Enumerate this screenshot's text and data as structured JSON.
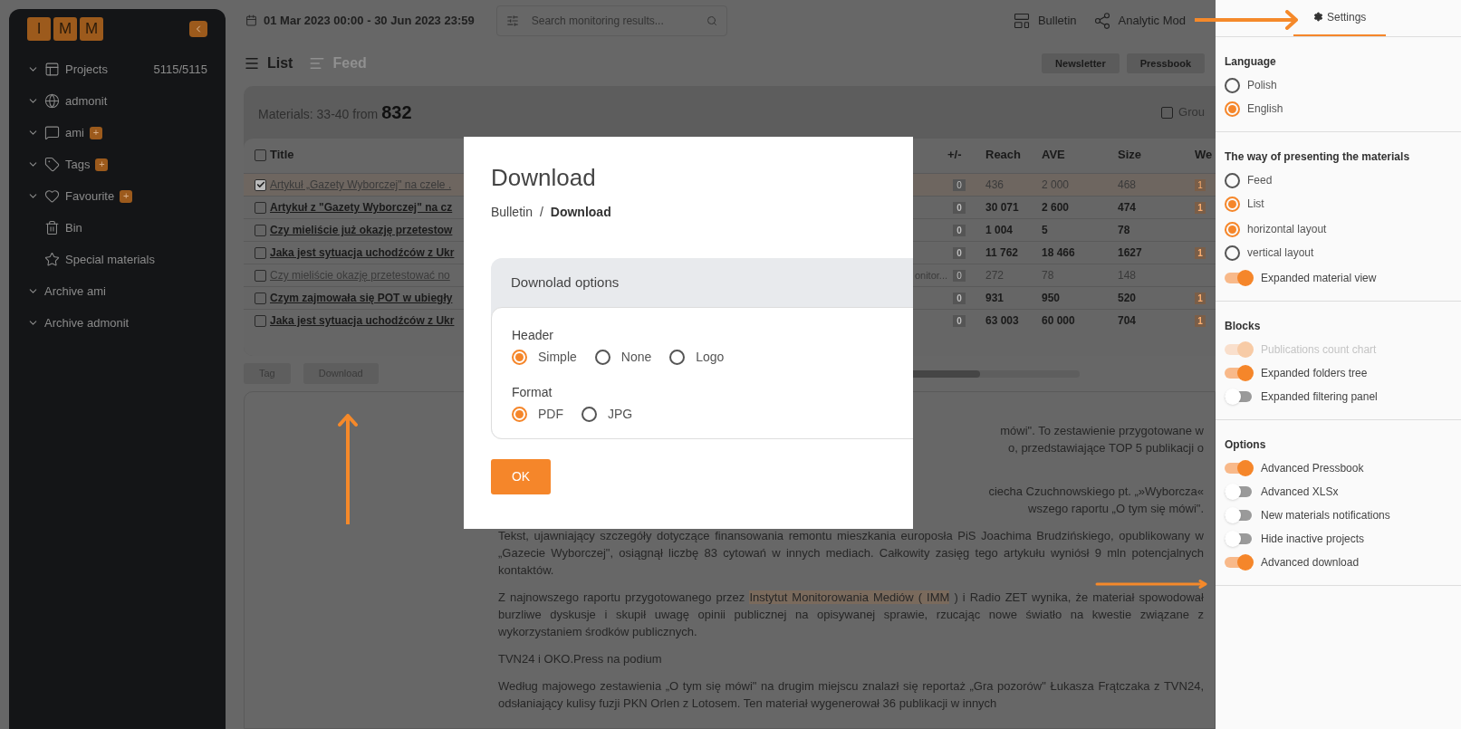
{
  "sidebar": {
    "logo": [
      "I",
      "M",
      "M"
    ],
    "items": [
      {
        "kind": "folder",
        "label": "Projects",
        "count": "5115/5115"
      },
      {
        "kind": "folder",
        "label": "admonit"
      },
      {
        "kind": "folder",
        "label": "ami",
        "badge": "+"
      },
      {
        "kind": "folder",
        "label": "Tags",
        "badge": "+"
      },
      {
        "kind": "folder",
        "label": "Favourite",
        "badge": "+"
      },
      {
        "kind": "leaf",
        "label": "Bin"
      },
      {
        "kind": "leaf",
        "label": "Special materials"
      },
      {
        "kind": "folder",
        "label": "Archive ami"
      },
      {
        "kind": "folder",
        "label": "Archive admonit"
      }
    ]
  },
  "top_bar": {
    "date_range": "01 Mar 2023 00:00 - 30 Jun 2023 23:59",
    "search": {
      "placeholder": "Search monitoring results..."
    },
    "nav": [
      "Bulletin",
      "Analytic Mod"
    ]
  },
  "view_tabs": [
    {
      "label": "List",
      "selected": true
    },
    {
      "label": "Feed",
      "selected": false
    }
  ],
  "actions": [
    "Newsletter",
    "Pressbook"
  ],
  "materials": {
    "label": "Materials:",
    "range": "33-40 from",
    "total": "832",
    "group": {
      "label": "Grou",
      "checked": false
    }
  },
  "table": {
    "select_all": {
      "checked": false
    },
    "columns": [
      "Title",
      "+/-",
      "Reach",
      "AVE",
      "Size",
      "We"
    ],
    "rows": [
      {
        "checked": true,
        "bold": false,
        "title": "Artykuł „Gazety Wyborczej\" na czele .",
        "change": "0",
        "reach": "436",
        "ave": "2 000",
        "size": "468",
        "weight": "1"
      },
      {
        "checked": false,
        "bold": true,
        "title": "Artykuł z \"Gazety Wyborczej\" na cz",
        "change": "0",
        "reach": "30 071",
        "ave": "2 600",
        "size": "474",
        "weight": "1"
      },
      {
        "checked": false,
        "bold": true,
        "title": "Czy mieliście już okazję przetestow",
        "change": "0",
        "reach": "1 004",
        "ave": "5",
        "size": "78"
      },
      {
        "checked": false,
        "bold": true,
        "title": "Jaka jest sytuacja uchodźców z Ukr",
        "change": "0",
        "reach": "11 762",
        "ave": "18 466",
        "size": "1627",
        "weight": "1"
      },
      {
        "checked": false,
        "bold": false,
        "title": "Czy mieliście okazję przetestować no",
        "column_3": "onitor...",
        "change": "0",
        "reach": "272",
        "ave": "78",
        "size": "148"
      },
      {
        "checked": false,
        "bold": true,
        "title": "Czym zajmowała się POT w ubiegły",
        "change": "0",
        "reach": "931",
        "ave": "950",
        "size": "520",
        "weight": "1"
      },
      {
        "checked": false,
        "bold": true,
        "title": "Jaka jest sytuacja uchodźców z Ukr",
        "change": "0",
        "reach": "63 003",
        "ave": "60 000",
        "size": "704",
        "weight": "1"
      }
    ]
  },
  "bulk_actions": [
    "Tag",
    "Download"
  ],
  "article": {
    "paragraphs": [
      {
        "kind": "partial",
        "lines": [
          "mówi\". To zestawienie przygotowane w",
          "o, przedstawiające TOP 5 publikacji o"
        ]
      },
      {
        "kind": "partial",
        "lines": [
          "ciecha Czuchnowskiego pt. „»Wyborcza«",
          "wszego raportu „O tym się mówi\"."
        ]
      },
      {
        "kind": "full",
        "segments": [
          {
            "text": "Tekst, ujawniający szczegóły dotyczące finansowania remontu mieszkania europosła PiS Joachima Brudzińskiego, opublikowany w „Gazecie Wyborczej\", osiągnął liczbę 83 cytowań w innych mediach. Całkowity zasięg tego artykułu wyniósł 9 mln potencjalnych kontaktów.",
            "highlighted": false
          }
        ]
      },
      {
        "kind": "full",
        "segments": [
          {
            "text": "Z najnowszego raportu przygotowanego przez ",
            "highlighted": false
          },
          {
            "text": "Instytut Monitorowania Mediów ( IMM",
            "highlighted": true
          },
          {
            "text": " ) i Radio ZET wynika, że materiał spowodował burzliwe dyskusje i skupił uwagę opinii publicznej na opisywanej sprawie, rzucając nowe światło na kwestie związane z wykorzystaniem środków publicznych.",
            "highlighted": false
          }
        ]
      },
      {
        "kind": "full",
        "segments": [
          {
            "text": "TVN24 i OKO.Press na podium",
            "highlighted": false
          }
        ]
      },
      {
        "kind": "full",
        "segments": [
          {
            "text": "Według majowego zestawienia „O tym się mówi\" na drugim miejscu znalazł się reportaż „Gra pozorów\" Łukasza Frątczaka z TVN24, odsłaniający kulisy fuzji PKN Orlen z Lotosem. Ten materiał wygenerował 36 publikacji w innych",
            "highlighted": false
          }
        ]
      }
    ]
  },
  "modal": {
    "title": "Download",
    "breadcrumb": [
      "Bulletin",
      "Download"
    ],
    "separator": "/",
    "options_title": "Downolad options",
    "groups": [
      {
        "label": "Header",
        "options": [
          {
            "label": "Simple",
            "selected": true
          },
          {
            "label": "None",
            "selected": false
          },
          {
            "label": "Logo",
            "selected": false
          }
        ]
      },
      {
        "label": "Format",
        "options": [
          {
            "label": "PDF",
            "selected": true
          },
          {
            "label": "JPG",
            "selected": false
          }
        ]
      }
    ],
    "ok": "OK"
  },
  "settings": {
    "tab": {
      "label": "Settings",
      "selected": true
    },
    "sections": [
      {
        "title": "Language",
        "groups": [
          [
            {
              "kind": "radio",
              "label": "Polish",
              "on": false
            },
            {
              "kind": "radio",
              "label": "English",
              "on": true
            }
          ]
        ]
      },
      {
        "title": "The way of presenting the materials",
        "groups": [
          [
            {
              "kind": "radio",
              "label": "Feed",
              "on": false
            },
            {
              "kind": "radio",
              "label": "List",
              "on": true
            }
          ],
          [
            {
              "kind": "radio",
              "label": "horizontal layout",
              "on": true
            },
            {
              "kind": "radio",
              "label": "vertical layout",
              "on": false
            }
          ],
          [
            {
              "kind": "toggle",
              "label": "Expanded material view",
              "on": true,
              "disabled": false
            }
          ]
        ]
      },
      {
        "title": "Blocks",
        "groups": [
          [
            {
              "kind": "toggle",
              "label": "Publications count chart",
              "on": true,
              "disabled": true
            },
            {
              "kind": "toggle",
              "label": "Expanded folders tree",
              "on": true,
              "disabled": false
            },
            {
              "kind": "toggle",
              "label": "Expanded filtering panel",
              "on": false,
              "disabled": false
            }
          ]
        ]
      },
      {
        "title": "Options",
        "groups": [
          [
            {
              "kind": "toggle",
              "label": "Advanced Pressbook",
              "on": true,
              "disabled": false
            },
            {
              "kind": "toggle",
              "label": "Advanced XLSx",
              "on": false,
              "disabled": false
            },
            {
              "kind": "toggle",
              "label": "New materials notifications",
              "on": false,
              "disabled": false
            },
            {
              "kind": "toggle",
              "label": "Hide inactive projects",
              "on": false,
              "disabled": false
            },
            {
              "kind": "toggle",
              "label": "Advanced download",
              "on": true,
              "disabled": false
            }
          ]
        ]
      }
    ]
  }
}
